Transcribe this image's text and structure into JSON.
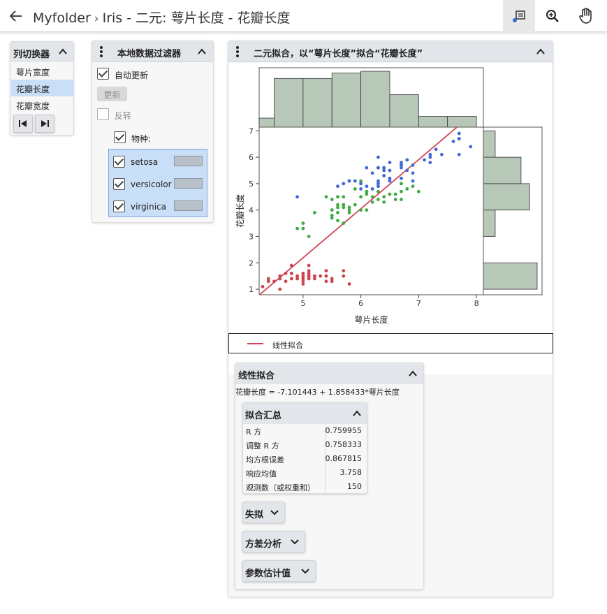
{
  "header": {
    "breadcrumb": [
      "Myfolder",
      "Iris - 二元: 萼片长度 - 花瓣长度"
    ],
    "tools": [
      "notes-icon",
      "zoom-icon",
      "hand-icon"
    ]
  },
  "column_switcher": {
    "title": "列切换器",
    "items": [
      {
        "label": "萼片宽度",
        "selected": false
      },
      {
        "label": "花瓣长度",
        "selected": true
      },
      {
        "label": "花瓣宽度",
        "selected": false
      }
    ],
    "buttons": [
      "first-icon",
      "last-icon"
    ]
  },
  "data_filter": {
    "title": "本地数据过滤器",
    "auto_update_label": "自动更新",
    "update_button": "更新",
    "invert_label": "反转",
    "column_label": "物种:",
    "levels": [
      "setosa",
      "versicolor",
      "virginica"
    ]
  },
  "bivariate": {
    "title": "二元拟合，以“萼片长度”拟合“花瓣长度”",
    "legend_label": "线性拟合",
    "colors": {
      "setosa": "#cc4450",
      "versicolor": "#3faa42",
      "virginica": "#4169d8",
      "fit": "#d04555",
      "hist": "#b8c8b8"
    }
  },
  "chart_data": {
    "type": "scatter",
    "xlabel": "萼片长度",
    "ylabel": "花瓣长度",
    "xlim": [
      4.24,
      8.12
    ],
    "ylim": [
      0.79,
      7.14
    ],
    "xticks": [
      "5",
      "6",
      "7",
      "8"
    ],
    "yticks": [
      "1",
      "2",
      "3",
      "4",
      "5",
      "6",
      "7"
    ],
    "fit_line": {
      "intercept": -7.101443,
      "slope": 1.858433
    },
    "x_histogram": {
      "bin_edges": [
        4.0,
        4.5,
        5.0,
        5.5,
        6.0,
        6.5,
        7.0,
        7.5,
        8.0
      ],
      "counts": [
        5,
        27,
        27,
        30,
        31,
        18,
        6,
        6
      ]
    },
    "y_histogram": {
      "bin_edges": [
        1,
        2,
        3,
        4,
        5,
        6,
        7
      ],
      "counts": [
        50,
        0,
        11,
        43,
        35,
        11
      ]
    },
    "series": [
      {
        "name": "setosa",
        "points": [
          [
            5.1,
            1.4
          ],
          [
            4.9,
            1.4
          ],
          [
            4.7,
            1.3
          ],
          [
            4.6,
            1.5
          ],
          [
            5.0,
            1.4
          ],
          [
            5.4,
            1.7
          ],
          [
            4.6,
            1.4
          ],
          [
            5.0,
            1.5
          ],
          [
            4.4,
            1.4
          ],
          [
            4.9,
            1.5
          ],
          [
            5.4,
            1.5
          ],
          [
            4.8,
            1.6
          ],
          [
            4.8,
            1.4
          ],
          [
            4.3,
            1.1
          ],
          [
            5.8,
            1.2
          ],
          [
            5.7,
            1.5
          ],
          [
            5.4,
            1.3
          ],
          [
            5.1,
            1.4
          ],
          [
            5.7,
            1.7
          ],
          [
            5.1,
            1.5
          ],
          [
            5.4,
            1.7
          ],
          [
            5.1,
            1.5
          ],
          [
            4.6,
            1.0
          ],
          [
            5.1,
            1.7
          ],
          [
            4.8,
            1.9
          ],
          [
            5.0,
            1.6
          ],
          [
            5.0,
            1.6
          ],
          [
            5.2,
            1.5
          ],
          [
            5.2,
            1.4
          ],
          [
            4.7,
            1.6
          ],
          [
            4.8,
            1.6
          ],
          [
            5.4,
            1.5
          ],
          [
            5.2,
            1.5
          ],
          [
            5.5,
            1.4
          ],
          [
            4.9,
            1.5
          ],
          [
            5.0,
            1.2
          ],
          [
            5.5,
            1.3
          ],
          [
            4.9,
            1.4
          ],
          [
            4.4,
            1.3
          ],
          [
            5.1,
            1.5
          ],
          [
            5.0,
            1.3
          ],
          [
            4.5,
            1.3
          ],
          [
            4.4,
            1.3
          ],
          [
            5.0,
            1.6
          ],
          [
            5.1,
            1.9
          ],
          [
            4.8,
            1.4
          ],
          [
            5.1,
            1.6
          ],
          [
            4.6,
            1.4
          ],
          [
            5.3,
            1.5
          ],
          [
            5.0,
            1.4
          ]
        ]
      },
      {
        "name": "versicolor",
        "points": [
          [
            7.0,
            4.7
          ],
          [
            6.4,
            4.5
          ],
          [
            6.9,
            4.9
          ],
          [
            5.5,
            4.0
          ],
          [
            6.5,
            4.6
          ],
          [
            5.7,
            4.5
          ],
          [
            6.3,
            4.7
          ],
          [
            4.9,
            3.3
          ],
          [
            6.6,
            4.6
          ],
          [
            5.2,
            3.9
          ],
          [
            5.0,
            3.5
          ],
          [
            5.9,
            4.2
          ],
          [
            6.0,
            4.0
          ],
          [
            6.1,
            4.7
          ],
          [
            5.6,
            3.6
          ],
          [
            6.7,
            4.4
          ],
          [
            5.6,
            4.5
          ],
          [
            5.8,
            4.1
          ],
          [
            6.2,
            4.5
          ],
          [
            5.6,
            3.9
          ],
          [
            5.9,
            4.8
          ],
          [
            6.1,
            4.0
          ],
          [
            6.3,
            4.9
          ],
          [
            6.1,
            4.7
          ],
          [
            6.4,
            4.3
          ],
          [
            6.6,
            4.4
          ],
          [
            6.8,
            4.8
          ],
          [
            6.7,
            5.0
          ],
          [
            6.0,
            4.5
          ],
          [
            5.7,
            3.5
          ],
          [
            5.5,
            3.8
          ],
          [
            5.5,
            3.7
          ],
          [
            5.8,
            3.9
          ],
          [
            6.0,
            5.1
          ],
          [
            5.4,
            4.5
          ],
          [
            6.0,
            4.5
          ],
          [
            6.7,
            4.7
          ],
          [
            6.3,
            4.4
          ],
          [
            5.6,
            4.1
          ],
          [
            5.5,
            4.0
          ],
          [
            5.5,
            4.4
          ],
          [
            6.1,
            4.6
          ],
          [
            5.8,
            4.0
          ],
          [
            5.0,
            3.3
          ],
          [
            5.6,
            4.2
          ],
          [
            5.7,
            4.2
          ],
          [
            5.7,
            4.2
          ],
          [
            6.2,
            4.3
          ],
          [
            5.1,
            3.0
          ],
          [
            5.7,
            4.1
          ]
        ]
      },
      {
        "name": "virginica",
        "points": [
          [
            6.3,
            6.0
          ],
          [
            5.8,
            5.1
          ],
          [
            7.1,
            5.9
          ],
          [
            6.3,
            5.6
          ],
          [
            6.5,
            5.8
          ],
          [
            7.6,
            6.6
          ],
          [
            4.9,
            4.5
          ],
          [
            7.3,
            6.3
          ],
          [
            6.7,
            5.8
          ],
          [
            7.2,
            6.1
          ],
          [
            6.5,
            5.1
          ],
          [
            6.4,
            5.3
          ],
          [
            6.8,
            5.5
          ],
          [
            5.7,
            5.0
          ],
          [
            5.8,
            5.1
          ],
          [
            6.4,
            5.3
          ],
          [
            6.5,
            5.5
          ],
          [
            7.7,
            6.7
          ],
          [
            7.7,
            6.9
          ],
          [
            6.0,
            5.0
          ],
          [
            6.9,
            5.7
          ],
          [
            5.6,
            4.9
          ],
          [
            7.7,
            6.7
          ],
          [
            6.3,
            4.9
          ],
          [
            6.7,
            5.7
          ],
          [
            7.2,
            6.0
          ],
          [
            6.2,
            4.8
          ],
          [
            6.1,
            4.9
          ],
          [
            6.4,
            5.6
          ],
          [
            7.2,
            5.8
          ],
          [
            7.4,
            6.1
          ],
          [
            7.9,
            6.4
          ],
          [
            6.4,
            5.6
          ],
          [
            6.3,
            5.1
          ],
          [
            6.1,
            5.6
          ],
          [
            7.7,
            6.1
          ],
          [
            6.3,
            5.6
          ],
          [
            6.4,
            5.5
          ],
          [
            6.0,
            4.8
          ],
          [
            6.9,
            5.4
          ],
          [
            6.7,
            5.6
          ],
          [
            6.9,
            5.1
          ],
          [
            5.8,
            5.1
          ],
          [
            6.8,
            5.9
          ],
          [
            6.7,
            5.7
          ],
          [
            6.7,
            5.2
          ],
          [
            6.3,
            5.0
          ],
          [
            6.5,
            5.2
          ],
          [
            6.2,
            5.4
          ],
          [
            5.9,
            5.1
          ]
        ]
      }
    ]
  },
  "linear_fit": {
    "title": "线性拟合",
    "equation": "花瓣长度 = -7.101443 + 1.858433*萼片长度",
    "summary": {
      "title": "拟合汇总",
      "rows": [
        {
          "label": "R 方",
          "value": "0.759955"
        },
        {
          "label": "调整 R 方",
          "value": "0.758333"
        },
        {
          "label": "均方根误差",
          "value": "0.867815"
        },
        {
          "label": "响应均值",
          "value": "3.758"
        },
        {
          "label": "观测数（或权重和）",
          "value": "150"
        }
      ]
    },
    "collapsed": [
      "失拟",
      "方差分析",
      "参数估计值"
    ]
  }
}
